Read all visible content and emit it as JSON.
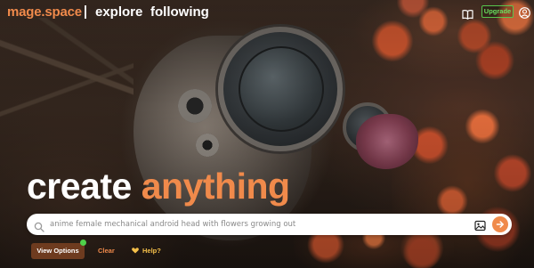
{
  "header": {
    "logo": "mage.space",
    "nav": {
      "explore": "explore",
      "following": "following"
    },
    "upgrade_label": "Upgrade"
  },
  "hero": {
    "word1": "create",
    "word2": "anything"
  },
  "search": {
    "placeholder": "anime female mechanical android head with flowers growing out",
    "value": ""
  },
  "options": {
    "view_options_label": "View Options",
    "clear_label": "Clear",
    "help_label": "Help?"
  },
  "icons": {
    "book": "book-open-icon",
    "user": "user-circle-icon",
    "search": "search-icon",
    "image_upload": "image-icon",
    "go": "arrow-right-icon",
    "help": "hand-heart-icon"
  },
  "colors": {
    "brand_orange": "#f08a4b",
    "upgrade_green": "#57c54d",
    "view_options_bg": "#6e3b1f",
    "help_yellow": "#f5c04a",
    "status_dot": "#4fd14a"
  }
}
